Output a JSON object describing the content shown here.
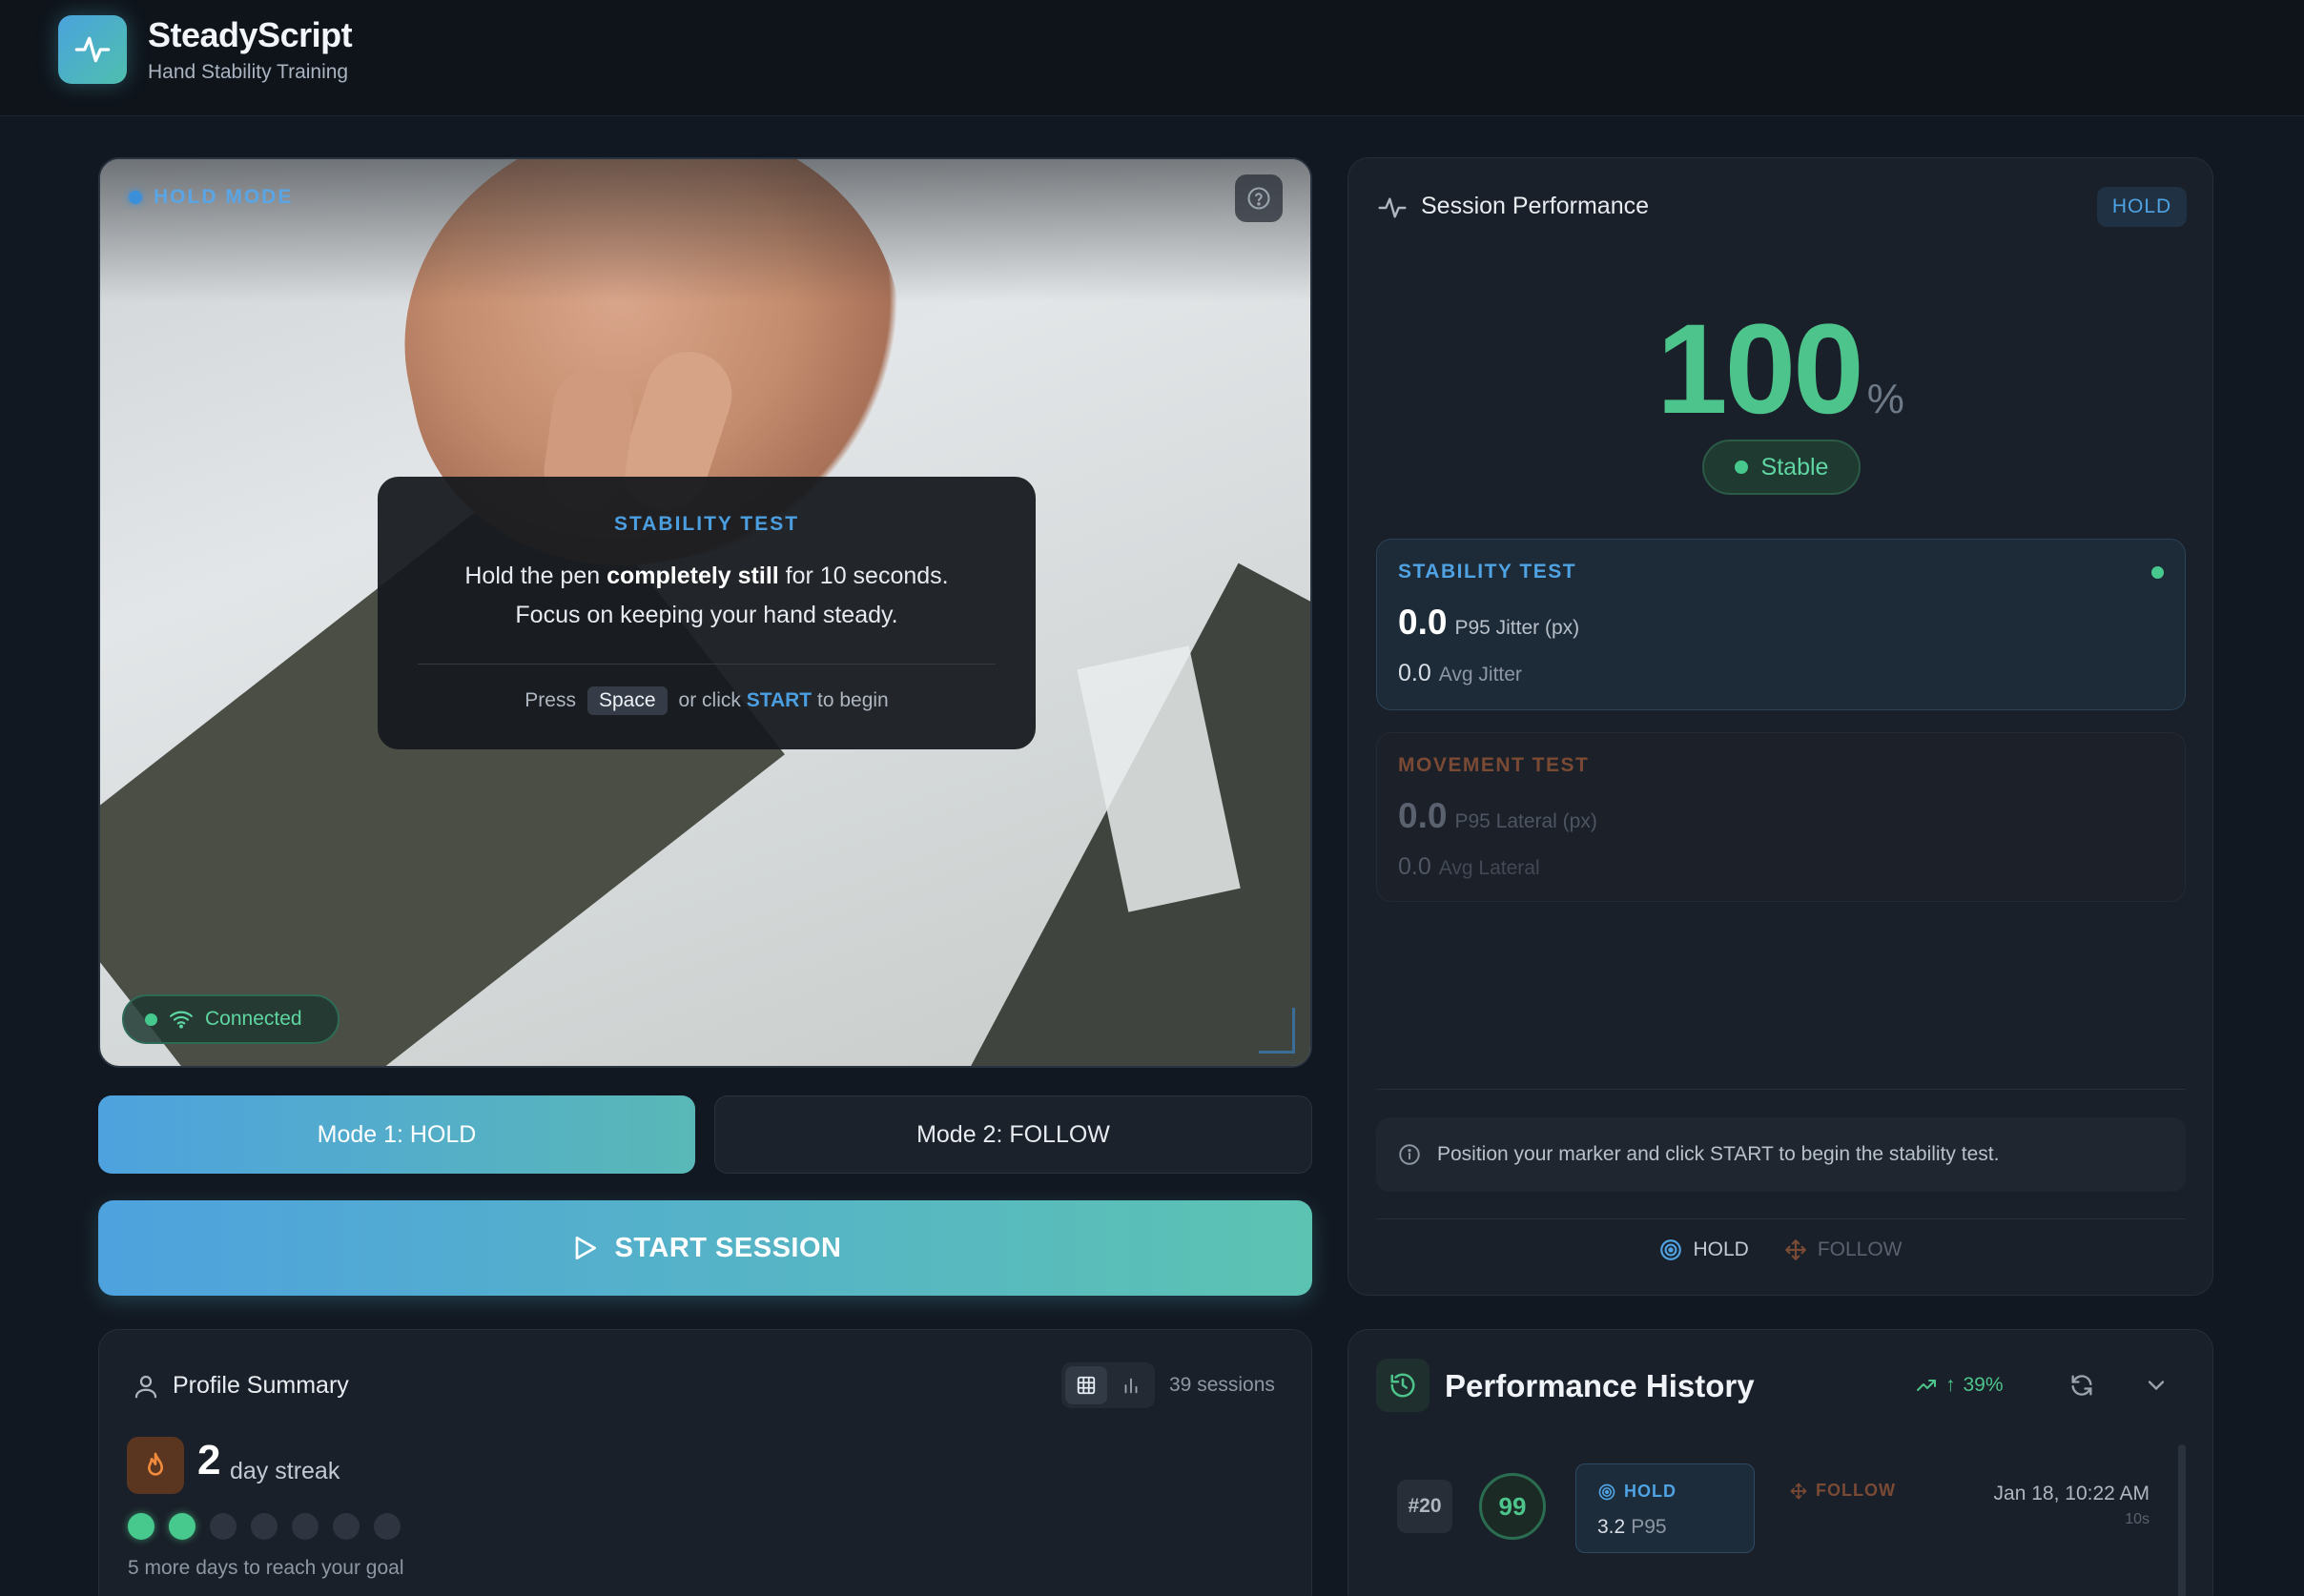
{
  "app": {
    "title": "SteadyScript",
    "subtitle": "Hand Stability Training"
  },
  "camera": {
    "mode_label": "HOLD MODE",
    "connection_status": "Connected",
    "instruction": {
      "title": "STABILITY TEST",
      "line1_pre": "Hold the pen ",
      "line1_bold": "completely still",
      "line1_post": " for 10 seconds.",
      "line2": "Focus on keeping your hand steady.",
      "press": "Press",
      "key": "Space",
      "or_click": "or click",
      "start_word": "START",
      "to_begin": "to begin"
    }
  },
  "controls": {
    "mode1": "Mode 1: HOLD",
    "mode2": "Mode 2: FOLLOW",
    "start": "START SESSION"
  },
  "profile": {
    "title": "Profile Summary",
    "sessions": "39 sessions",
    "streak_count": "2",
    "streak_label": "day streak",
    "streak_days_done": 2,
    "streak_days_total": 7,
    "streak_note": "5 more days to reach your goal"
  },
  "performance": {
    "title": "Session Performance",
    "badge": "HOLD",
    "score": "100",
    "score_unit": "%",
    "status": "Stable",
    "stability": {
      "title": "STABILITY TEST",
      "p95_value": "0.0",
      "p95_label": "P95 Jitter (px)",
      "avg_value": "0.0",
      "avg_label": "Avg Jitter"
    },
    "movement": {
      "title": "MOVEMENT TEST",
      "p95_value": "0.0",
      "p95_label": "P95 Lateral (px)",
      "avg_value": "0.0",
      "avg_label": "Avg Lateral"
    },
    "info": "Position your marker and click START to begin the stability test.",
    "footer_hold": "HOLD",
    "footer_follow": "FOLLOW"
  },
  "history": {
    "title": "Performance History",
    "trend": "39%",
    "entry": {
      "number": "#20",
      "score": "99",
      "hold_label": "HOLD",
      "hold_value": "3.2",
      "hold_unit": "P95",
      "follow_label": "FOLLOW",
      "date": "Jan 18, 10:22 AM",
      "duration": "10s"
    }
  },
  "colors": {
    "accent_blue": "#4fa3e3",
    "accent_green": "#4cc48b",
    "follow_orange": "#7a4a35",
    "background": "#121821"
  }
}
